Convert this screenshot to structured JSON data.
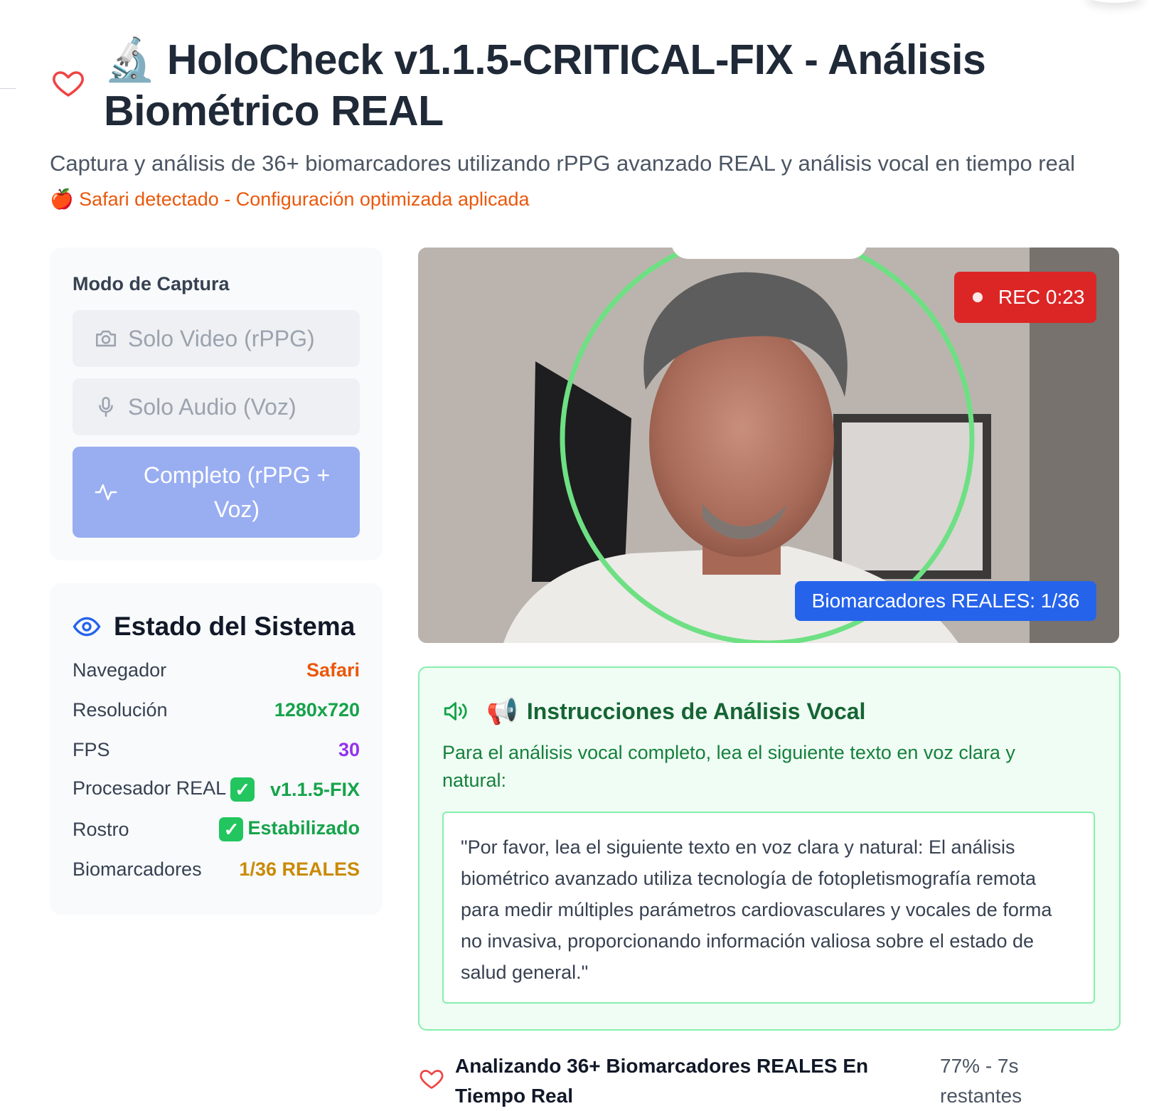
{
  "header": {
    "title_icon": "microscope-icon",
    "title_emoji": "🔬",
    "title": "HoloCheck v1.1.5-CRITICAL-FIX - Análisis Biométrico REAL",
    "subtitle": "Captura y análisis de 36+ biomarcadores utilizando rPPG avanzado REAL y análisis vocal en tiempo real",
    "browser_note_icon": "🍎",
    "browser_note": "Safari detectado - Configuración optimizada aplicada"
  },
  "capture_mode": {
    "label": "Modo de Captura",
    "options": [
      {
        "label": "Solo Video (rPPG)",
        "icon": "camera-icon",
        "active": false
      },
      {
        "label": "Solo Audio (Voz)",
        "icon": "microphone-icon",
        "active": false
      },
      {
        "label": "Completo (rPPG + Voz)",
        "icon": "activity-icon",
        "active": true
      }
    ]
  },
  "system_status": {
    "title": "Estado del Sistema",
    "icon": "eye-icon",
    "rows": [
      {
        "key": "Navegador",
        "value": "Safari",
        "color": "#ea580c"
      },
      {
        "key": "Resolución",
        "value": "1280x720",
        "color": "#16a34a"
      },
      {
        "key": "FPS",
        "value": "30",
        "color": "#9333ea"
      },
      {
        "key": "Procesador REAL",
        "check": "✓",
        "value": "v1.1.5-FIX",
        "color": "#16a34a"
      },
      {
        "key": "Rostro",
        "check": "✓",
        "value": "Estabilizado",
        "color": "#16a34a"
      },
      {
        "key": "Biomarcadores",
        "value": "1/36 REALES",
        "color": "#ca8a04"
      }
    ]
  },
  "video": {
    "rec_label": "REC 0:23",
    "biomarkers_badge": "Biomarcadores REALES: 1/36",
    "face_guide_color": "#6ee083"
  },
  "vocal": {
    "icon": "volume-icon",
    "emoji": "📢",
    "title": "Instrucciones de Análisis Vocal",
    "instruction": "Para el análisis vocal completo, lea el siguiente texto en voz clara y natural:",
    "passage": "\"Por favor, lea el siguiente texto en voz clara y natural: El análisis biométrico avanzado utiliza tecnología de fotopletismografía remota para medir múltiples parámetros cardiovasculares y vocales de forma no invasiva, proporcionando información valiosa sobre el estado de salud general.\""
  },
  "progress": {
    "icon": "heart-icon",
    "message": "Analizando 36+ Biomarcadores REALES En Tiempo Real",
    "percent": 77,
    "percent_label": "77% - 7s restantes"
  }
}
